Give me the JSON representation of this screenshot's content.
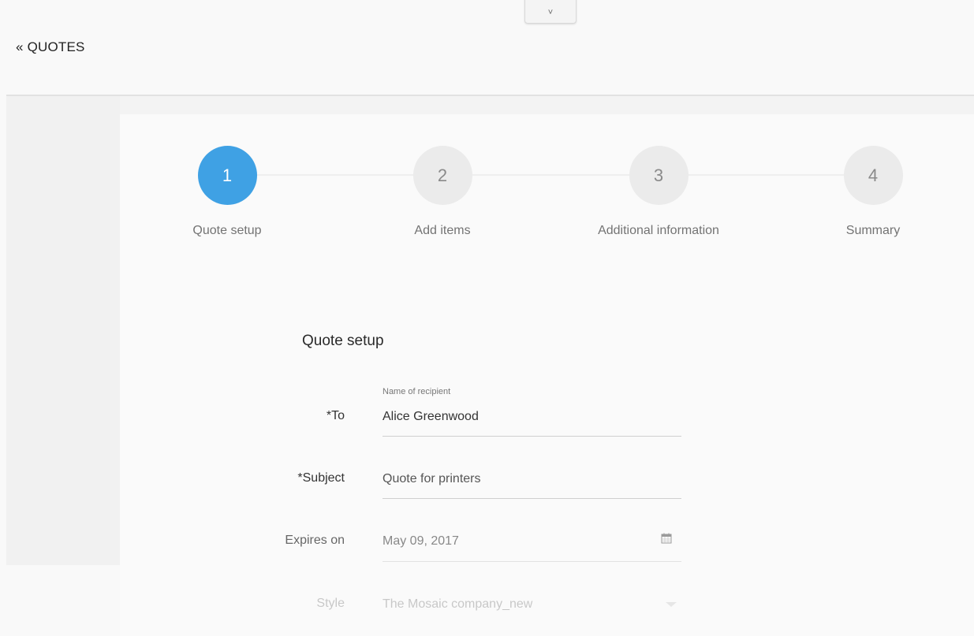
{
  "header": {
    "back_link": "« QUOTES",
    "toggle_glyph": "˅"
  },
  "stepper": {
    "steps": [
      {
        "number": "1",
        "label": "Quote setup",
        "active": true
      },
      {
        "number": "2",
        "label": "Add items",
        "active": false
      },
      {
        "number": "3",
        "label": "Additional information",
        "active": false
      },
      {
        "number": "4",
        "label": "Summary",
        "active": false
      }
    ]
  },
  "form": {
    "title": "Quote setup",
    "to": {
      "label": "*To",
      "hint": "Name of recipient",
      "value": "Alice Greenwood"
    },
    "subject": {
      "label": "*Subject",
      "value": "Quote for printers"
    },
    "expires": {
      "label": "Expires on",
      "value": "May 09, 2017",
      "icon": "calendar-icon"
    },
    "style": {
      "label": "Style",
      "value": "The Mosaic company_new",
      "icon": "dropdown-arrow-icon"
    }
  },
  "colors": {
    "accent": "#3fa1e4",
    "inactive_step": "#ebebeb"
  }
}
